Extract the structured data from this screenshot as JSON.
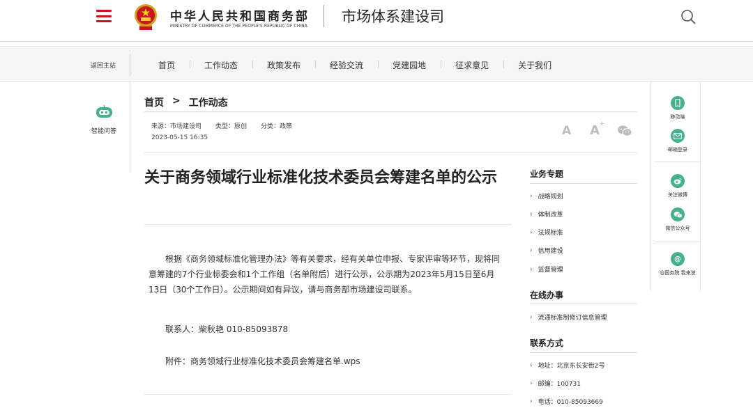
{
  "header": {
    "ministry_cn": "中华人民共和国商务部",
    "ministry_en": "MINISTRY OF COMMERCE OF THE PEOPLE'S REPUBLIC OF CHINA",
    "site_title": "市场体系建设司"
  },
  "nav": {
    "back_home": "返回主站",
    "items": [
      "首页",
      "工作动态",
      "政策发布",
      "经验交流",
      "党建园地",
      "征求意见",
      "关于我们"
    ]
  },
  "left": {
    "robot_label": "智能问答"
  },
  "breadcrumb": {
    "home": "首页",
    "sep": ">",
    "current": "工作动态"
  },
  "meta": {
    "source": "来源：市场建设司",
    "type": "类型：原创",
    "category": "分类：政策",
    "date": "2023-05-15 16:35"
  },
  "font_controls": {
    "small": "A",
    "large": "A",
    "large_mark": "+"
  },
  "article": {
    "title": "关于商务领域行业标准化技术委员会筹建名单的公示",
    "paragraph": "根据《商务领域标准化管理办法》等有关要求，经有关单位申报、专家评审等环节，现将同意筹建的7个行业标委会和1个工作组（名单附后）进行公示，公示期为2023年5月15日至6月13日（30个工作日）。公示期间如有异议，请与商务部市场建设司联系。",
    "contact": "联系人：柴秋艳 010-85093878",
    "attachment_label": "附件：",
    "attachment_link": "商务领域行业标准化技术委员会筹建名单.wps"
  },
  "sidebar": {
    "topics_heading": "业务专题",
    "topics": [
      "战略规划",
      "体制改革",
      "法规标准",
      "信用建设",
      "监督管理"
    ],
    "online_heading": "在线办事",
    "online": [
      "流通标准制修订信息管理"
    ],
    "contact_heading": "联系方式",
    "contact": [
      "地址：北京东长安街2号",
      "邮编：100731",
      "电话：010-85093669"
    ]
  },
  "right_panel": {
    "items": [
      {
        "label": "移动端",
        "icon": "mobile-icon"
      },
      {
        "label": "邮箱登录",
        "icon": "mail-icon"
      },
      {
        "label": "关注微博",
        "icon": "weibo-icon"
      },
      {
        "label": "微信公众号",
        "icon": "wechat-icon"
      },
      {
        "label": "@国务院 我来说",
        "icon": "at-icon"
      }
    ]
  },
  "colors": {
    "brand_red": "#c8161d",
    "accent_green": "#44b08d"
  }
}
